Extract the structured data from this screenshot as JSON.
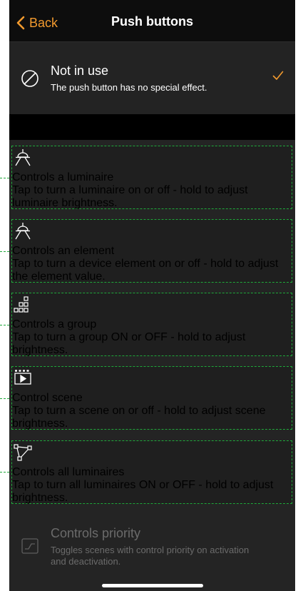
{
  "nav": {
    "back_label": "Back",
    "title": "Push buttons"
  },
  "options": [
    {
      "title": "Not in use",
      "subtitle": "The push button has no special effect.",
      "icon": "prohibited-icon",
      "selected": true
    },
    {
      "title": "Controls a luminaire",
      "subtitle": "Tap to turn a luminaire on or off - hold to adjust luminaire brightness.",
      "icon": "luminaire-icon"
    },
    {
      "title": "Controls an element",
      "subtitle": "Tap to turn a device element on or off - hold to adjust the element value.",
      "icon": "element-icon"
    },
    {
      "title": "Controls a group",
      "subtitle": "Tap to turn a group ON or OFF - hold to adjust brightness.",
      "icon": "group-icon"
    },
    {
      "title": "Control scene",
      "subtitle": "Tap to turn a scene on or off - hold to adjust scene brightness.",
      "icon": "scene-icon"
    },
    {
      "title": "Controls all luminaires",
      "subtitle": "Tap to turn all luminaires ON or OFF - hold to adjust brightness.",
      "icon": "all-luminaires-icon"
    },
    {
      "title": "Controls priority",
      "subtitle": "Toggles scenes with control priority on activation and deactivation.",
      "icon": "priority-icon",
      "disabled": true
    }
  ],
  "colors": {
    "accent": "#f29a2e",
    "highlight": "#1fa83a",
    "background": "#242424",
    "navbar": "#0d0d0d"
  }
}
